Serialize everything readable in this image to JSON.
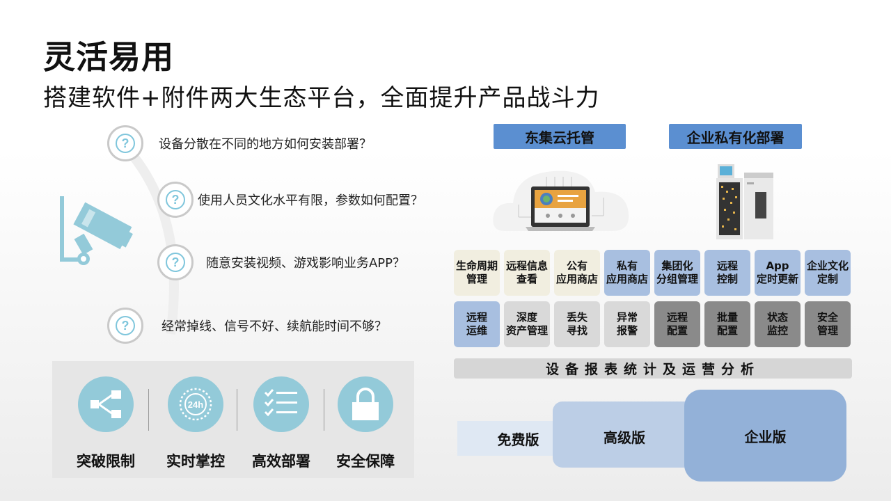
{
  "title": "灵活易用",
  "subtitle": "搭建软件+附件两大生态平台，全面提升产品战斗力",
  "questions": [
    {
      "icon": "question-icon",
      "text": "设备分散在不同的地方如何安装部署？"
    },
    {
      "icon": "question-icon",
      "text": "使用人员文化水平有限，参数如何配置？"
    },
    {
      "icon": "question-icon",
      "text": "随意安装视频、游戏影响业务APP？"
    },
    {
      "icon": "question-icon",
      "text": "经常掉线、信号不好、续航能时间不够？"
    }
  ],
  "question_mark": "?",
  "features": [
    {
      "icon": "share-icon",
      "label": "突破限制"
    },
    {
      "icon": "clock-24h-icon",
      "label": "实时掌控",
      "badge": "24h"
    },
    {
      "icon": "checklist-icon",
      "label": "高效部署"
    },
    {
      "icon": "lock-icon",
      "label": "安全保障"
    }
  ],
  "deploy": {
    "cloud_label": "东集云托管",
    "private_label": "企业私有化部署"
  },
  "tiles_row1": [
    {
      "text": "生命周期\n管理",
      "style": "cream"
    },
    {
      "text": "远程信息\n查看",
      "style": "cream"
    },
    {
      "text": "公有\n应用商店",
      "style": "cream"
    },
    {
      "text": "私有\n应用商店",
      "style": "blue"
    },
    {
      "text": "集团化\n分组管理",
      "style": "blue"
    },
    {
      "text": "远程\n控制",
      "style": "blue"
    },
    {
      "text": "App\n定时更新",
      "style": "blue"
    },
    {
      "text": "企业文化\n定制",
      "style": "blue"
    }
  ],
  "tiles_row2": [
    {
      "text": "远程\n运维",
      "style": "blue"
    },
    {
      "text": "深度\n资产管理",
      "style": "lgray"
    },
    {
      "text": "丢失\n寻找",
      "style": "lgray"
    },
    {
      "text": "异常\n报警",
      "style": "lgray"
    },
    {
      "text": "远程\n配置",
      "style": "mgray"
    },
    {
      "text": "批量\n配置",
      "style": "mgray"
    },
    {
      "text": "状态\n监控",
      "style": "mgray"
    },
    {
      "text": "安全\n管理",
      "style": "mgray"
    }
  ],
  "report_bar": "设备报表统计及运营分析",
  "tiers": {
    "free": "免费版",
    "advanced": "高级版",
    "enterprise": "企业版"
  },
  "colors": {
    "accent_blue": "#5b8fd1",
    "feature_circle": "#93cad9",
    "question_ring": "#7fc6dc"
  }
}
